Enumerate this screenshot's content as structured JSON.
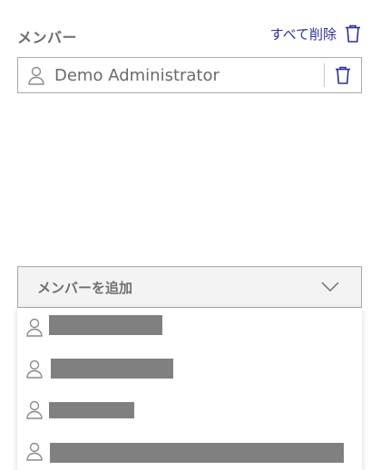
{
  "members_section": {
    "label": "メンバー",
    "delete_all_label": "すべて削除"
  },
  "members": [
    {
      "name": "Demo Administrator"
    }
  ],
  "add_member": {
    "label": "メンバーを追加"
  },
  "dropdown": {
    "options_redacted": true,
    "option_count": 4
  },
  "colors": {
    "accent": "#2f2f9e",
    "border": "#a8a8a8",
    "redaction": "#808080"
  },
  "icons": [
    "trash-icon",
    "person-icon",
    "chevron-down-icon"
  ]
}
